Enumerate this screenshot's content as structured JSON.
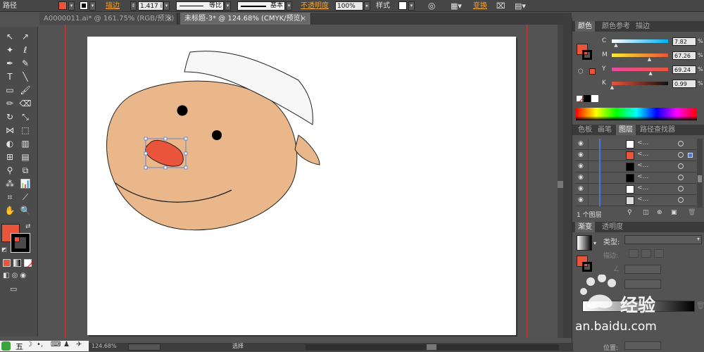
{
  "control_bar": {
    "title": "路径",
    "stroke_label": "描边",
    "stroke_width": "1.417 i",
    "stroke_style_1": "等比",
    "stroke_style_2": "基本",
    "opacity_label": "不透明度",
    "opacity_value": "100%",
    "style_label": "样式",
    "transform_label": "变换",
    "fill_color": "#e8553a",
    "opacity_color": "#f0a030"
  },
  "tabs": [
    {
      "label": "A0000011.ai* @ 161.75% (RGB/预览)",
      "close": "×"
    },
    {
      "label": "未标题-3* @ 124.68% (CMYK/预览)",
      "close": "×"
    }
  ],
  "tools": {
    "fill_color": "#e8553a",
    "stroke_color": "#000000"
  },
  "color_panel": {
    "tabs": [
      "颜色",
      "颜色参考",
      "描边"
    ],
    "channels": [
      {
        "name": "C",
        "value": "7.82",
        "gradient": "linear-gradient(90deg,#ffffff,#00aeef)"
      },
      {
        "name": "M",
        "value": "67.26",
        "gradient": "linear-gradient(90deg,#f6ec2f,#e8553a)"
      },
      {
        "name": "Y",
        "value": "69.24",
        "gradient": "linear-gradient(90deg,#e84aa2,#e8553a)"
      },
      {
        "name": "K",
        "value": "0.99",
        "gradient": "linear-gradient(90deg,#e8553a,#111111)"
      }
    ],
    "fill_color": "#e8553a"
  },
  "layers_panel": {
    "tabs": [
      "色板",
      "画笔",
      "图层",
      "路径查找器"
    ],
    "rows": [
      {
        "name": "<...",
        "thumb": "#ffffff"
      },
      {
        "name": "<...",
        "thumb": "#e8553a"
      },
      {
        "name": "<...",
        "thumb": "#000000"
      },
      {
        "name": "<...",
        "thumb": "#000000"
      },
      {
        "name": "<...",
        "thumb": "#ffffff"
      },
      {
        "name": "<...",
        "thumb": "#dddddd"
      }
    ],
    "footer": "1 个图层"
  },
  "gradient_panel": {
    "tabs": [
      "渐变",
      "透明度"
    ],
    "type_label": "类型:",
    "stroke_label": "描边:",
    "position_label": "位置:"
  },
  "status_bar": {
    "zoom": "124.68%",
    "tool": "选择"
  },
  "taskbar": {
    "ime": "五"
  },
  "watermark": {
    "brand": "经验",
    "url": "an.baidu.com"
  }
}
